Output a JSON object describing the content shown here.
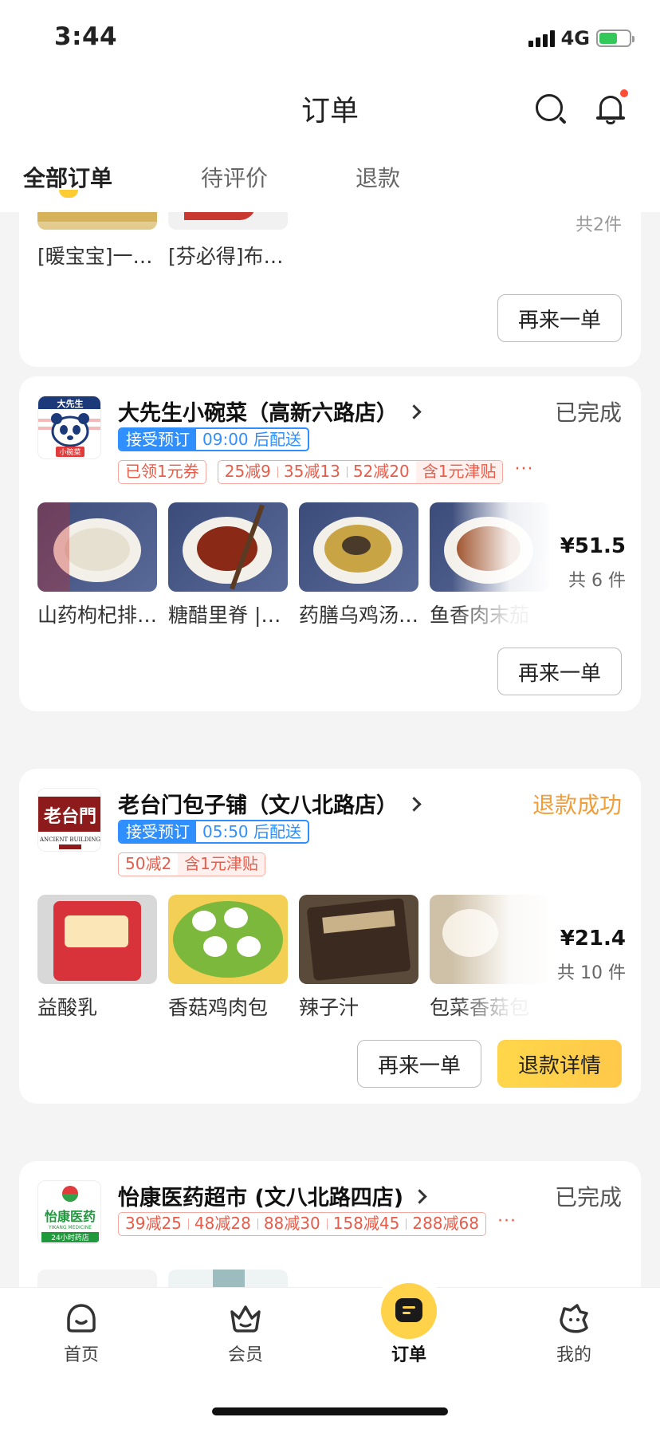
{
  "status_bar": {
    "time": "3:44",
    "network": "4G"
  },
  "header": {
    "title": "订单"
  },
  "tabs": [
    {
      "label": "全部订单",
      "active": true
    },
    {
      "label": "待评价",
      "active": false
    },
    {
      "label": "退款",
      "active": false
    }
  ],
  "orders": [
    {
      "items": [
        {
          "name": "[暖宝宝]一…"
        },
        {
          "name": "[芬必得]布…"
        }
      ],
      "count_partial": "共2件",
      "reorder_label": "再来一单"
    },
    {
      "store_name": "大先生小碗菜（高新六路店）",
      "status": "已完成",
      "booking": {
        "tag": "接受预订",
        "time": "09:00 后配送"
      },
      "coupon": "已领1元券",
      "promos": [
        "25减9",
        "35减13",
        "52减20"
      ],
      "subsidy": "含1元津贴",
      "more": "···",
      "items": [
        {
          "name": "山药枸杞排…"
        },
        {
          "name": "糖醋里脊 |…"
        },
        {
          "name": "药膳乌鸡汤…"
        },
        {
          "name": "鱼香肉末茄"
        }
      ],
      "price": "¥51.5",
      "count": "共 6 件",
      "reorder_label": "再来一单"
    },
    {
      "store_name": "老台门包子铺（文八北路店）",
      "status": "退款成功",
      "booking": {
        "tag": "接受预订",
        "time": "05:50 后配送"
      },
      "promos": [
        "50减2"
      ],
      "subsidy": "含1元津贴",
      "items": [
        {
          "name": "益酸乳"
        },
        {
          "name": "香菇鸡肉包"
        },
        {
          "name": "辣子汁"
        },
        {
          "name": "包菜香菇包"
        }
      ],
      "price": "¥21.4",
      "count": "共 10 件",
      "reorder_label": "再来一单",
      "refund_detail_label": "退款详情"
    },
    {
      "store_name": "怡康医药超市 (文八北路四店)",
      "status": "已完成",
      "promos": [
        "39减25",
        "48减28",
        "88减30",
        "158减45",
        "288减68"
      ],
      "more": "···"
    }
  ],
  "bottom_nav": [
    {
      "label": "首页",
      "icon": "home-icon"
    },
    {
      "label": "会员",
      "icon": "crown-icon"
    },
    {
      "label": "订单",
      "icon": "order-icon",
      "active": true
    },
    {
      "label": "我的",
      "icon": "profile-icon"
    }
  ],
  "logos": {
    "daxiansheng": {
      "line1": "大先生",
      "line2": "小碗菜"
    },
    "laotaimen": {
      "main": "老台門",
      "sub": "ANCIENT BUILDING"
    },
    "yikang": {
      "main": "怡康医药",
      "sub1": "YIKANG MEDICINE",
      "sub2": "24小时药店"
    }
  },
  "colors": {
    "accent_yellow": "#ffd24a",
    "booking_blue": "#2f8fff",
    "promo_red": "#e95c4a",
    "refund_orange": "#f29d38"
  }
}
